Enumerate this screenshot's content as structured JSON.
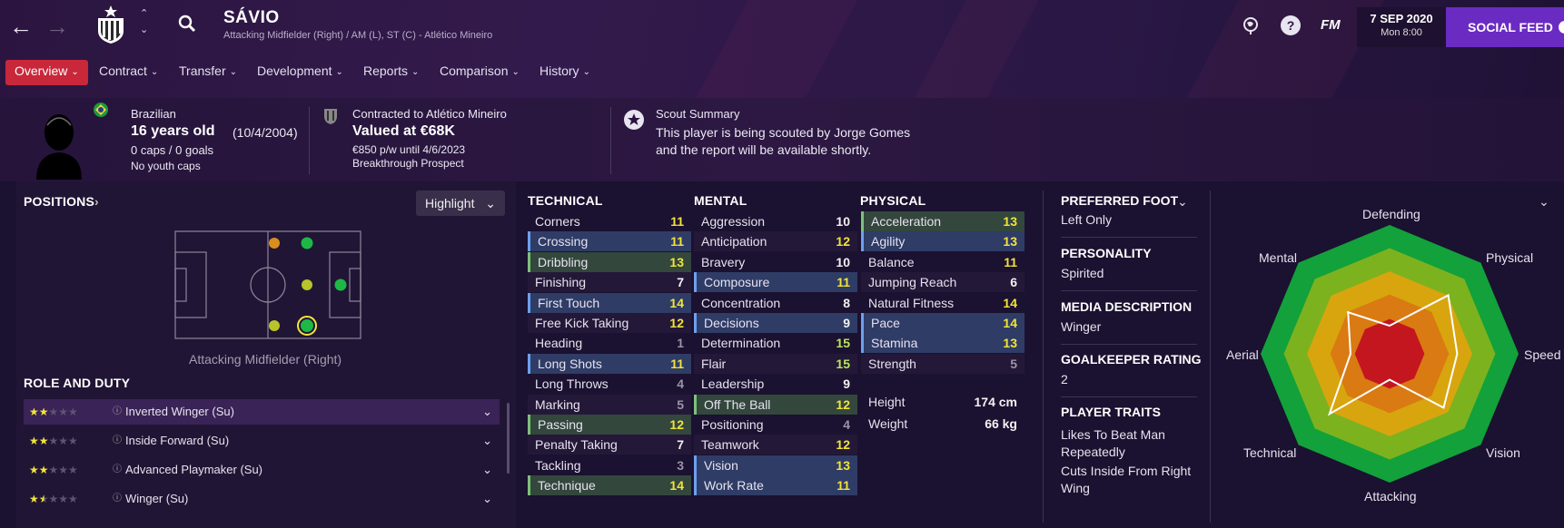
{
  "header": {
    "player_name": "SÁVIO",
    "subtitle": "Attacking Midfielder (Right) / AM (L), ST (C) - Atlético Mineiro",
    "date": "7 SEP 2020",
    "day_time": "Mon 8:00",
    "fm_label": "FM",
    "help_label": "?",
    "social_feed": "SOCIAL FEED",
    "accent": "#c8283a",
    "social_color": "#6a2bc2"
  },
  "tabs": [
    {
      "label": "Overview",
      "active": true
    },
    {
      "label": "Contract"
    },
    {
      "label": "Transfer"
    },
    {
      "label": "Development"
    },
    {
      "label": "Reports"
    },
    {
      "label": "Comparison"
    },
    {
      "label": "History"
    }
  ],
  "info": {
    "nationality": "Brazilian",
    "age": "16 years old",
    "dob": "(10/4/2004)",
    "caps": "0 caps / 0 goals",
    "youth_caps": "No youth caps",
    "contracted_to": "Contracted to Atlético Mineiro",
    "value": "Valued at €68K",
    "wage": "€850 p/w until 4/6/2023",
    "prospect": "Breakthrough Prospect",
    "scout_title": "Scout Summary",
    "scout_line1": "This player is being scouted by Jorge Gomes",
    "scout_line2": "and the report will be available shortly."
  },
  "positions": {
    "title": "POSITIONS",
    "highlight_label": "Highlight",
    "position_caption": "Attacking Midfielder (Right)"
  },
  "roles": {
    "title": "ROLE AND DUTY",
    "items": [
      {
        "label": "Inverted Winger (Su)",
        "stars": 2,
        "selected": true
      },
      {
        "label": "Inside Forward (Su)",
        "stars": 2
      },
      {
        "label": "Advanced Playmaker (Su)",
        "stars": 2
      },
      {
        "label": "Winger (Su)",
        "stars": 1.5
      }
    ]
  },
  "technical": {
    "title": "TECHNICAL",
    "items": [
      {
        "name": "Corners",
        "value": "11",
        "hl": ""
      },
      {
        "name": "Crossing",
        "value": "11",
        "hl": "blue"
      },
      {
        "name": "Dribbling",
        "value": "13",
        "hl": "green"
      },
      {
        "name": "Finishing",
        "value": "7",
        "hl": ""
      },
      {
        "name": "First Touch",
        "value": "14",
        "hl": "blue"
      },
      {
        "name": "Free Kick Taking",
        "value": "12",
        "hl": ""
      },
      {
        "name": "Heading",
        "value": "1",
        "hl": ""
      },
      {
        "name": "Long Shots",
        "value": "11",
        "hl": "blue"
      },
      {
        "name": "Long Throws",
        "value": "4",
        "hl": ""
      },
      {
        "name": "Marking",
        "value": "5",
        "hl": ""
      },
      {
        "name": "Passing",
        "value": "12",
        "hl": "green"
      },
      {
        "name": "Penalty Taking",
        "value": "7",
        "hl": ""
      },
      {
        "name": "Tackling",
        "value": "3",
        "hl": ""
      },
      {
        "name": "Technique",
        "value": "14",
        "hl": "green"
      }
    ]
  },
  "mental": {
    "title": "MENTAL",
    "items": [
      {
        "name": "Aggression",
        "value": "10",
        "hl": ""
      },
      {
        "name": "Anticipation",
        "value": "12",
        "hl": ""
      },
      {
        "name": "Bravery",
        "value": "10",
        "hl": ""
      },
      {
        "name": "Composure",
        "value": "11",
        "hl": "blue"
      },
      {
        "name": "Concentration",
        "value": "8",
        "hl": ""
      },
      {
        "name": "Decisions",
        "value": "9",
        "hl": "blue"
      },
      {
        "name": "Determination",
        "value": "15",
        "hl": ""
      },
      {
        "name": "Flair",
        "value": "15",
        "hl": ""
      },
      {
        "name": "Leadership",
        "value": "9",
        "hl": ""
      },
      {
        "name": "Off The Ball",
        "value": "12",
        "hl": "green"
      },
      {
        "name": "Positioning",
        "value": "4",
        "hl": ""
      },
      {
        "name": "Teamwork",
        "value": "12",
        "hl": ""
      },
      {
        "name": "Vision",
        "value": "13",
        "hl": "blue"
      },
      {
        "name": "Work Rate",
        "value": "11",
        "hl": "blue"
      }
    ]
  },
  "physical": {
    "title": "PHYSICAL",
    "items": [
      {
        "name": "Acceleration",
        "value": "13",
        "hl": "green"
      },
      {
        "name": "Agility",
        "value": "13",
        "hl": "blue"
      },
      {
        "name": "Balance",
        "value": "11",
        "hl": ""
      },
      {
        "name": "Jumping Reach",
        "value": "6",
        "hl": ""
      },
      {
        "name": "Natural Fitness",
        "value": "14",
        "hl": ""
      },
      {
        "name": "Pace",
        "value": "14",
        "hl": "blue"
      },
      {
        "name": "Stamina",
        "value": "13",
        "hl": "blue"
      },
      {
        "name": "Strength",
        "value": "5",
        "hl": ""
      }
    ],
    "height_label": "Height",
    "height_value": "174 cm",
    "weight_label": "Weight",
    "weight_value": "66 kg"
  },
  "sidebar": {
    "foot_title": "PREFERRED FOOT",
    "foot_value": "Left Only",
    "personality_title": "PERSONALITY",
    "personality_value": "Spirited",
    "media_title": "MEDIA DESCRIPTION",
    "media_value": "Winger",
    "gk_title": "GOALKEEPER RATING",
    "gk_value": "2",
    "traits_title": "PLAYER TRAITS",
    "trait1_line1": "Likes To Beat Man",
    "trait1_line2": "Repeatedly",
    "trait2_line1": "Cuts Inside From Right",
    "trait2_line2": "Wing"
  },
  "radar": {
    "labels": [
      "Defending",
      "Physical",
      "Speed",
      "Vision",
      "Attacking",
      "Technical",
      "Aerial",
      "Mental"
    ],
    "values": [
      0.08,
      0.58,
      0.44,
      0.52,
      0.06,
      0.6,
      0.18,
      0.36
    ]
  }
}
